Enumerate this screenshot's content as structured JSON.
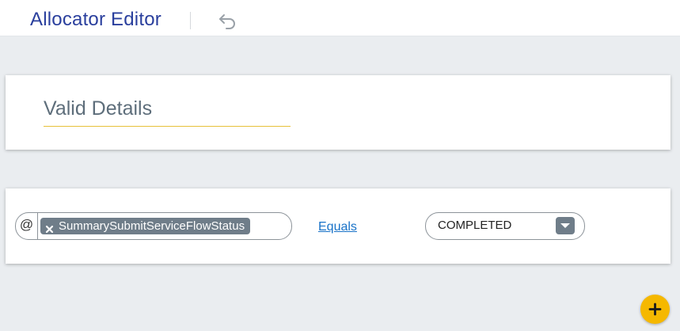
{
  "header": {
    "title": "Allocator Editor",
    "undo_icon": "undo-icon"
  },
  "details_card": {
    "title": "Valid Details"
  },
  "rule": {
    "variable_prefix": "@",
    "variable_chip": "SummarySubmitServiceFlowStatus",
    "remove_icon": "close-icon",
    "operator": "Equals",
    "value": "COMPLETED",
    "dropdown_icon": "chevron-down-icon"
  },
  "fab": {
    "icon": "plus-icon"
  },
  "colors": {
    "title_blue": "#2a3f9d",
    "accent_yellow": "#f5b800",
    "link_blue": "#1a73c8",
    "chip_gray": "#6f7d89",
    "background": "#eaedf0"
  }
}
